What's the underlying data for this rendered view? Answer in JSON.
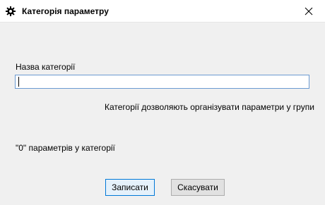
{
  "window": {
    "title": "Категорія параметру",
    "icon": "gear-icon"
  },
  "form": {
    "name_label": "Назва категорії",
    "name_value": "",
    "name_placeholder": "",
    "hint": "Категорії дозволяють організувати параметри у групи",
    "count_text": "\"0\" параметрів у категорії"
  },
  "buttons": {
    "save_label": "Записати",
    "cancel_label": "Скасувати"
  },
  "colors": {
    "accent": "#0078d7",
    "background": "#f0f0f0"
  }
}
